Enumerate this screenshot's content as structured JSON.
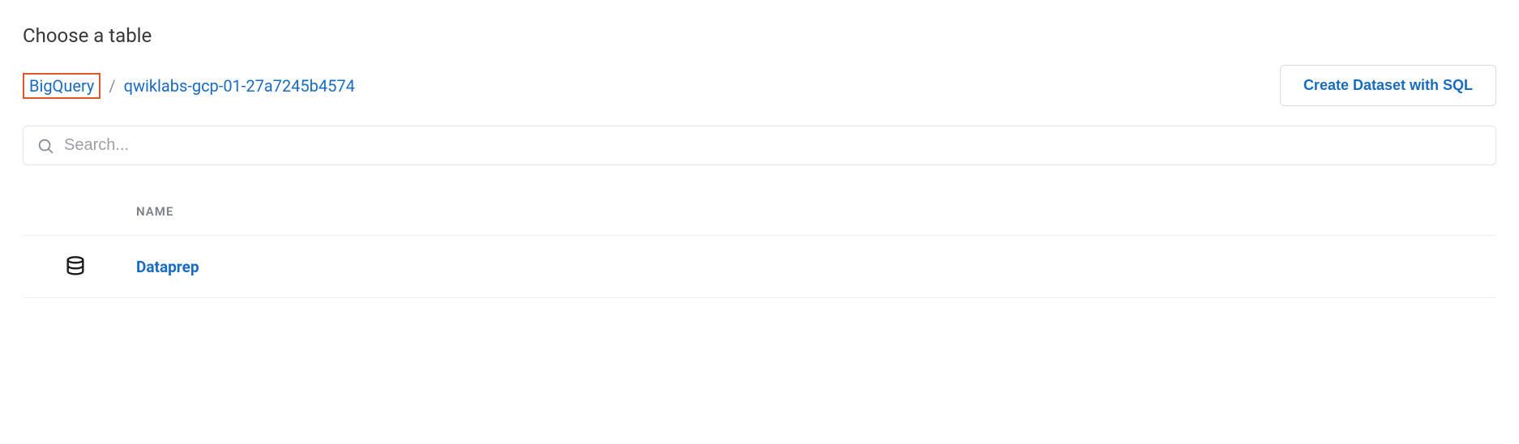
{
  "title": "Choose a table",
  "breadcrumb": {
    "root": "BigQuery",
    "separator": "/",
    "current": "qwiklabs-gcp-01-27a7245b4574"
  },
  "actions": {
    "create_dataset": "Create Dataset with SQL"
  },
  "search": {
    "placeholder": "Search..."
  },
  "table": {
    "header_name": "NAME",
    "rows": [
      {
        "name": "Dataprep"
      }
    ]
  }
}
